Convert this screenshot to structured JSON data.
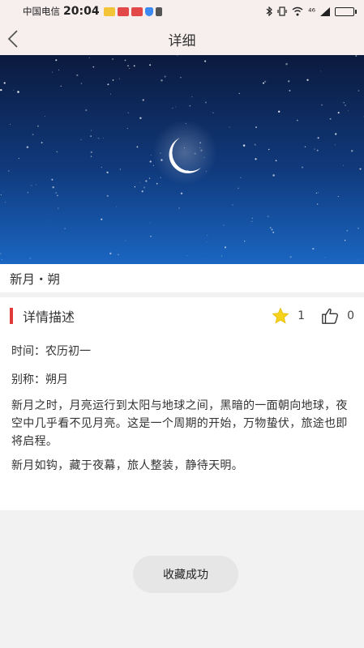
{
  "status_bar": {
    "carrier": "中国电信",
    "time": "20:04",
    "network": "⁴⁶",
    "battery_level": 0.85
  },
  "header": {
    "title": "详细",
    "back_icon": "chevron-left-icon"
  },
  "banner": {
    "description_icon": "crescent-moon-night-sky",
    "sky_top_color": "#0b1a3e",
    "sky_bottom_color": "#1a66c2"
  },
  "subtitle": "新月・朔",
  "card": {
    "heading": "详情描述",
    "accent_color": "#e03a3a",
    "star_count": "1",
    "like_count": "0",
    "time_line": "时间：农历初一",
    "alias_line": "别称：朔月",
    "paragraph1": "新月之时，月亮运行到太阳与地球之间，黑暗的一面朝向地球，夜空中几乎看不见月亮。这是一个周期的开始，万物蛰伏，旅途也即将启程。",
    "paragraph2": "新月如钩，藏于夜幕，旅人整装，静待天明。"
  },
  "toast": "收藏成功"
}
